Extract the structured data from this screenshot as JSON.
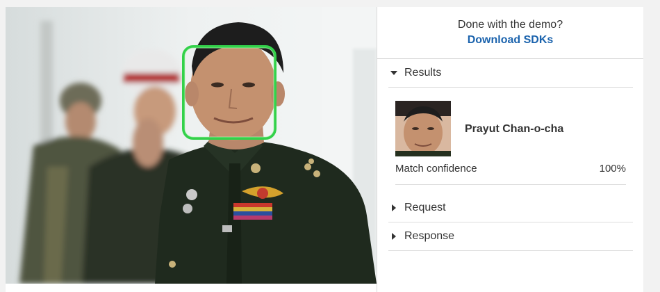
{
  "header": {
    "prompt": "Done with the demo?",
    "download_label": "Download SDKs"
  },
  "results": {
    "section_label": "Results",
    "expanded": true,
    "person_name": "Prayut Chan-o-cha",
    "confidence_label": "Match confidence",
    "confidence_value": "100%"
  },
  "request": {
    "section_label": "Request",
    "expanded": false
  },
  "response": {
    "section_label": "Response",
    "expanded": false
  },
  "colors": {
    "link": "#1b63ad",
    "face_box": "#33d14a"
  }
}
